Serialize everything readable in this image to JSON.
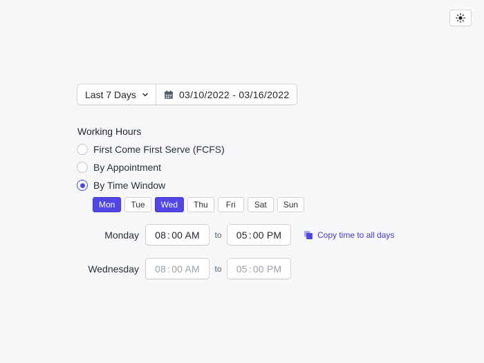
{
  "theme_toggle": {
    "icon": "sun-icon"
  },
  "range_picker": {
    "preset": "Last 7 Days",
    "date_range": "03/10/2022 - 03/16/2022"
  },
  "working_hours": {
    "title": "Working Hours",
    "options": [
      {
        "label": "First Come First Serve (FCFS)",
        "checked": false
      },
      {
        "label": "By Appointment",
        "checked": false
      },
      {
        "label": "By Time Window",
        "checked": true
      }
    ],
    "days": [
      {
        "label": "Mon",
        "selected": true
      },
      {
        "label": "Tue",
        "selected": false
      },
      {
        "label": "Wed",
        "selected": true
      },
      {
        "label": "Thu",
        "selected": false
      },
      {
        "label": "Fri",
        "selected": false
      },
      {
        "label": "Sat",
        "selected": false
      },
      {
        "label": "Sun",
        "selected": false
      }
    ],
    "rows": [
      {
        "day": "Monday",
        "start_h": "08",
        "start_m": "00 AM",
        "to": "to",
        "end_h": "05",
        "end_m": "00 PM"
      },
      {
        "day": "Wednesday",
        "start_h": "08",
        "start_m": "00 AM",
        "to": "to",
        "end_h": "05",
        "end_m": "00 PM"
      }
    ],
    "copy_label": "Copy time to all days"
  },
  "colors": {
    "accent": "#4f46e5",
    "background": "#f6f7f9"
  }
}
